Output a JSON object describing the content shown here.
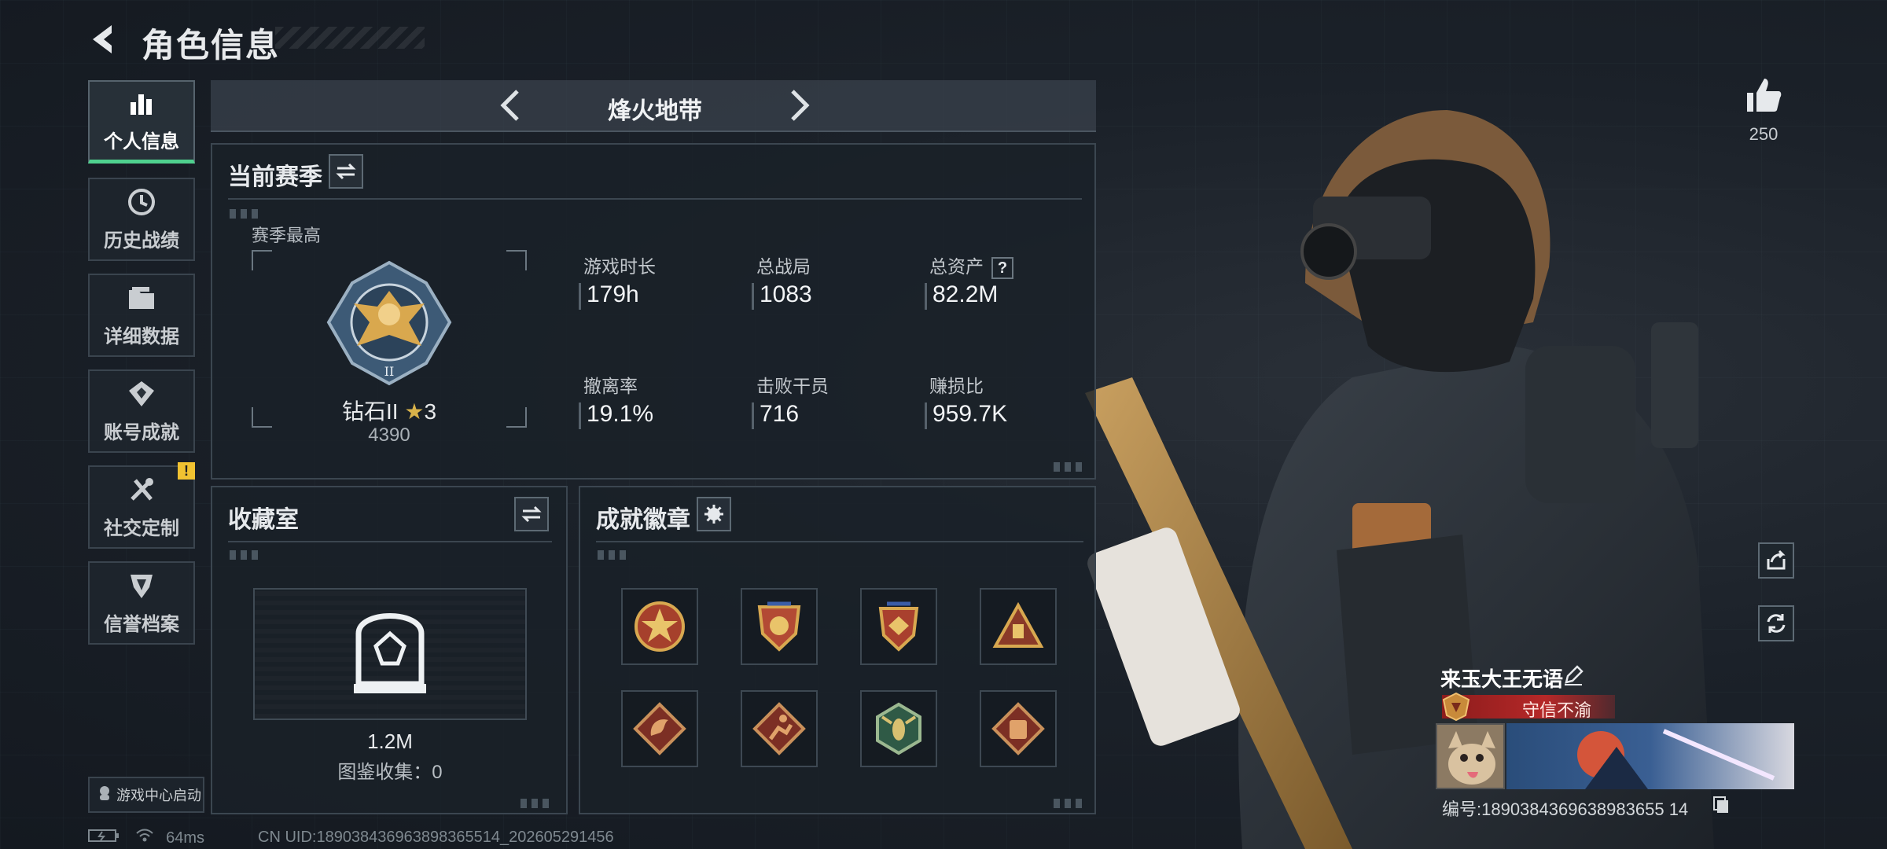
{
  "header": {
    "title": "角色信息"
  },
  "sidebar": {
    "items": [
      {
        "label": "个人信息",
        "icon": "bar-chart-icon",
        "active": true
      },
      {
        "label": "历史战绩",
        "icon": "history-clock-icon"
      },
      {
        "label": "详细数据",
        "icon": "folder-icon"
      },
      {
        "label": "账号成就",
        "icon": "achievement-medal-icon"
      },
      {
        "label": "社交定制",
        "icon": "tools-icon",
        "alert": "!"
      },
      {
        "label": "信誉档案",
        "icon": "reputation-shield-icon"
      }
    ],
    "game_center": "游戏中心启动"
  },
  "mode": {
    "name": "烽火地带"
  },
  "season": {
    "title": "当前赛季",
    "best_label": "赛季最高",
    "rank_name": "钻石II",
    "rank_stars": "3",
    "rank_score": "4390",
    "stats": [
      {
        "label": "游戏时长",
        "value": "179h"
      },
      {
        "label": "总战局",
        "value": "1083"
      },
      {
        "label": "总资产",
        "value": "82.2M",
        "help": "?"
      },
      {
        "label": "撤离率",
        "value": "19.1%"
      },
      {
        "label": "击败干员",
        "value": "716"
      },
      {
        "label": "赚损比",
        "value": "959.7K"
      }
    ]
  },
  "collection": {
    "title": "收藏室",
    "value": "1.2M",
    "count_text": "图鉴收集：0"
  },
  "achievements": {
    "title": "成就徽章",
    "badges": [
      "star-seal-badge",
      "eagle-shield-badge",
      "winged-shield-badge",
      "triangle-badge",
      "dragon-badge",
      "runner-badge",
      "hornet-badge",
      "vest-badge"
    ]
  },
  "profile": {
    "likes": "250",
    "name": "来玉大王无语",
    "title": "守信不渝",
    "id_text": "编号:1890384369638983655 14"
  },
  "footer": {
    "ping": "64ms",
    "uid": "CN UID:189038436963898365514_202605291456"
  },
  "colors": {
    "accent": "#4fd08e",
    "alert": "#f1c231",
    "title_red": "#b52828"
  }
}
